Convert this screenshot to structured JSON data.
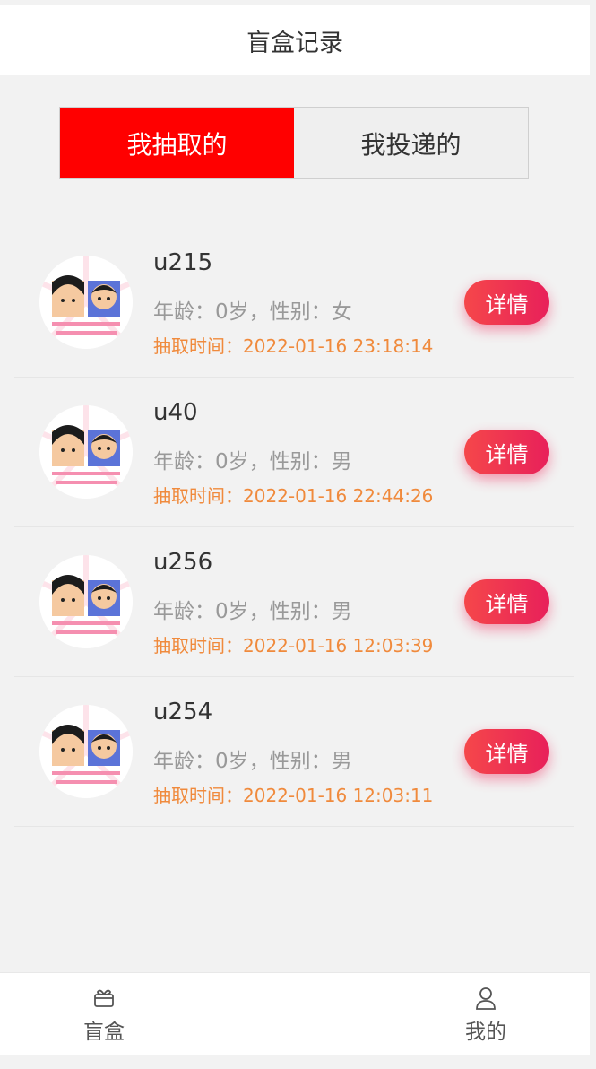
{
  "header": {
    "title": "盲盒记录"
  },
  "tabs": [
    {
      "label": "我抽取的",
      "active": true
    },
    {
      "label": "我投递的",
      "active": false
    }
  ],
  "records": [
    {
      "name": "u215",
      "info": "年龄：0岁，性别：女",
      "time": "抽取时间：2022-01-16 23:18:14",
      "button": "详情"
    },
    {
      "name": "u40",
      "info": "年龄：0岁，性别：男",
      "time": "抽取时间：2022-01-16 22:44:26",
      "button": "详情"
    },
    {
      "name": "u256",
      "info": "年龄：0岁，性别：男",
      "time": "抽取时间：2022-01-16 12:03:39",
      "button": "详情"
    },
    {
      "name": "u254",
      "info": "年龄：0岁，性别：男",
      "time": "抽取时间：2022-01-16 12:03:11",
      "button": "详情"
    }
  ],
  "bottom_nav": [
    {
      "label": "盲盒",
      "icon": "gift-box-icon"
    },
    {
      "label": "我的",
      "icon": "user-icon"
    }
  ],
  "colors": {
    "accent": "#ff0000",
    "button_gradient_start": "#f5474a",
    "button_gradient_end": "#e8205a",
    "time_text": "#f08a3c"
  }
}
